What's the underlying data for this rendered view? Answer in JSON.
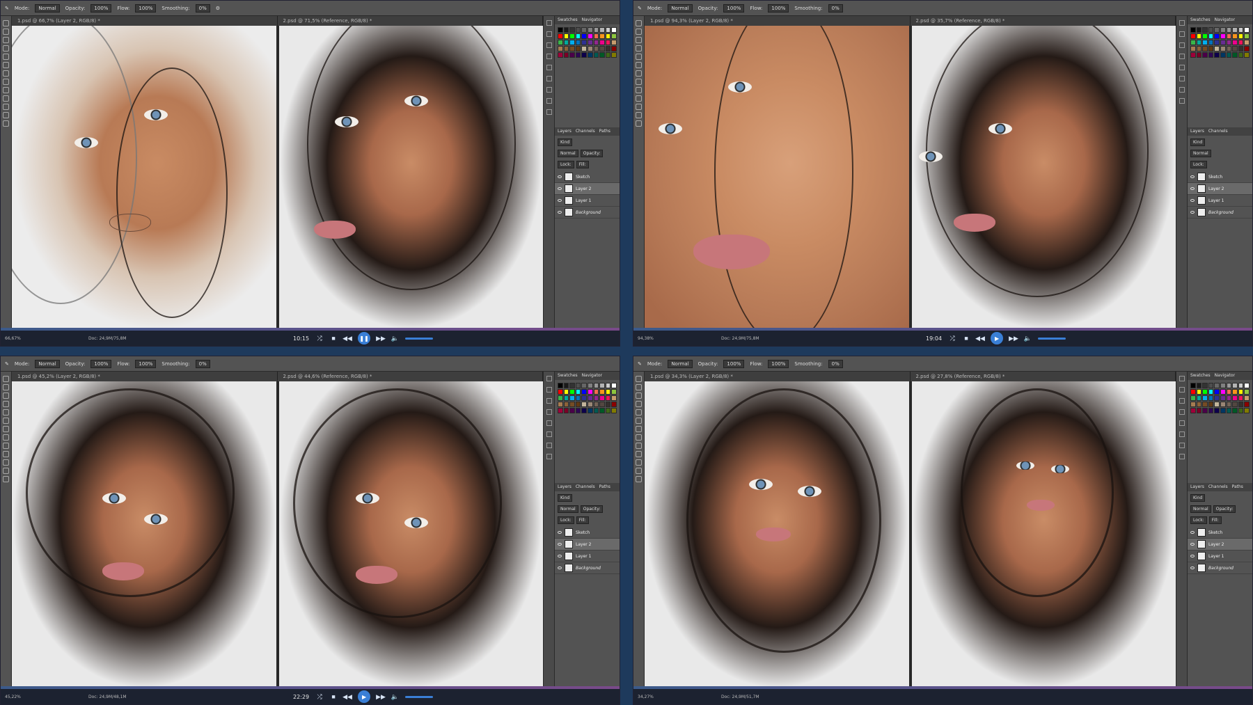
{
  "options_bar": {
    "mode_label": "Mode:",
    "mode_value": "Normal",
    "opacity_label": "Opacity:",
    "opacity_value": "100%",
    "flow_label": "Flow:",
    "flow_value": "100%",
    "smoothing_label": "Smoothing:",
    "smoothing_value": "0%"
  },
  "panels": {
    "swatches_tab": "Swatches",
    "navigator_tab": "Navigator",
    "layers_tab": "Layers",
    "channels_tab": "Channels",
    "paths_tab": "Paths",
    "kind_label": "Kind",
    "blend_mode": "Normal",
    "opacity_label": "Opacity:",
    "lock_label": "Lock:",
    "fill_label": "Fill:",
    "layers": [
      {
        "name": "Sketch",
        "selected": false,
        "italic": false
      },
      {
        "name": "Layer 2",
        "selected": true,
        "italic": false
      },
      {
        "name": "Layer 1",
        "selected": false,
        "italic": false
      },
      {
        "name": "Background",
        "selected": false,
        "italic": true
      }
    ]
  },
  "swatch_colors": [
    "#000000",
    "#1a1a1a",
    "#333333",
    "#4d4d4d",
    "#666666",
    "#808080",
    "#999999",
    "#b3b3b3",
    "#cccccc",
    "#ffffff",
    "#ff0000",
    "#ffff00",
    "#00ff00",
    "#00ffff",
    "#0000ff",
    "#ff00ff",
    "#f26c4f",
    "#f7941d",
    "#fff200",
    "#8dc63f",
    "#39b54a",
    "#00a99d",
    "#00aeef",
    "#0072bc",
    "#2e3192",
    "#662d91",
    "#92278f",
    "#ec008c",
    "#ed145b",
    "#c69c6d",
    "#a67c52",
    "#8c6239",
    "#754c24",
    "#603913",
    "#c2b59b",
    "#998675",
    "#736357",
    "#534741",
    "#362f2d",
    "#8b0000",
    "#9e0039",
    "#7a0026",
    "#4b0049",
    "#2e0854",
    "#0d004c",
    "#003663",
    "#005952",
    "#005826",
    "#406618",
    "#827b00"
  ],
  "quadrants": [
    {
      "tab_left": "1.psd @ 66,7% (Layer 2, RGB/8) *",
      "tab_right": "2.psd @ 71,5% (Reference, RGB/8) *",
      "zoom_left": "66,67%",
      "doc_info": "Doc: 24,9M/75,8M",
      "time": "10:15"
    },
    {
      "tab_left": "1.psd @ 94,3% (Layer 2, RGB/8) *",
      "tab_right": "2.psd @ 35,7% (Reference, RGB/8) *",
      "zoom_left": "94,38%",
      "doc_info": "Doc: 24,9M/75,8M",
      "time": "19:04"
    },
    {
      "tab_left": "1.psd @ 45,2% (Layer 2, RGB/8) *",
      "tab_right": "2.psd @ 44,6% (Reference, RGB/8) *",
      "zoom_left": "45,22%",
      "doc_info": "Doc: 24,9M/48,1M",
      "time": "22:29"
    },
    {
      "tab_left": "1.psd @ 34,3% (Layer 2, RGB/8) *",
      "tab_right": "2.psd @ 27,8% (Reference, RGB/8) *",
      "zoom_left": "34,27%",
      "doc_info": "Doc: 24,9M/51,7M",
      "time": ""
    }
  ]
}
